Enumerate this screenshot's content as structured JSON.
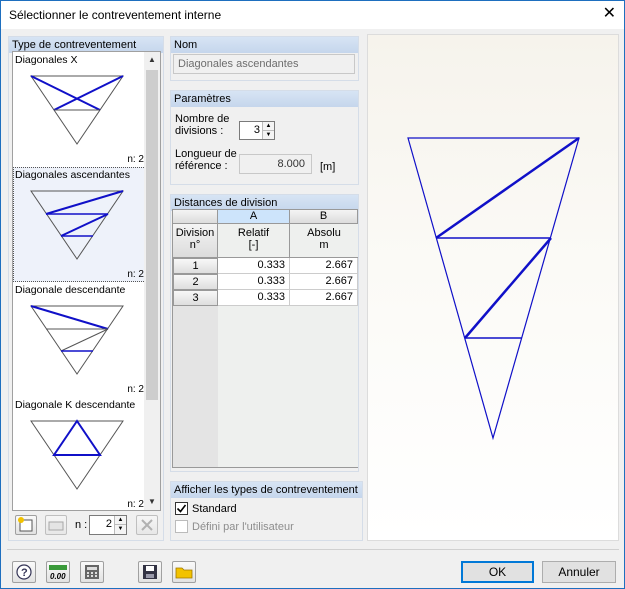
{
  "window": {
    "title": "Sélectionner le contreventement interne"
  },
  "types_panel": {
    "header": "Type de contreventement",
    "items": [
      {
        "label": "Diagonales X",
        "count": "n: 2"
      },
      {
        "label": "Diagonales ascendantes",
        "count": "n: 2"
      },
      {
        "label": "Diagonale descendante",
        "count": "n: 2"
      },
      {
        "label": "Diagonale K descendante",
        "count": "n: 2"
      }
    ],
    "n_label": "n :",
    "n_value": "2"
  },
  "name_panel": {
    "header": "Nom",
    "value": "Diagonales ascendantes"
  },
  "params_panel": {
    "header": "Paramètres",
    "divisions_label_1": "Nombre de",
    "divisions_label_2": "divisions :",
    "divisions_value": "3",
    "ref_label_1": "Longueur de",
    "ref_label_2": "référence :",
    "ref_value": "8.000",
    "ref_unit": "[m]"
  },
  "division_panel": {
    "header": "Distances de division",
    "col_a_letter": "A",
    "col_b_letter": "B",
    "row_header_1": "Division",
    "row_header_2": "n°",
    "col_a_1": "Relatif",
    "col_a_2": "[-]",
    "col_b_1": "Absolu",
    "col_b_2": "m",
    "rows": [
      {
        "n": "1",
        "rel": "0.333",
        "abs": "2.667"
      },
      {
        "n": "2",
        "rel": "0.333",
        "abs": "2.667"
      },
      {
        "n": "3",
        "rel": "0.333",
        "abs": "2.667"
      }
    ]
  },
  "show_panel": {
    "header": "Afficher les types de contreventement",
    "standard_label": "Standard",
    "standard_checked": true,
    "user_label": "Défini par l'utilisateur",
    "user_checked": false
  },
  "footer": {
    "ok_label": "OK",
    "cancel_label": "Annuler"
  },
  "colors": {
    "brace_blue": "#1010c8",
    "header_blue": "#cde4fb"
  }
}
